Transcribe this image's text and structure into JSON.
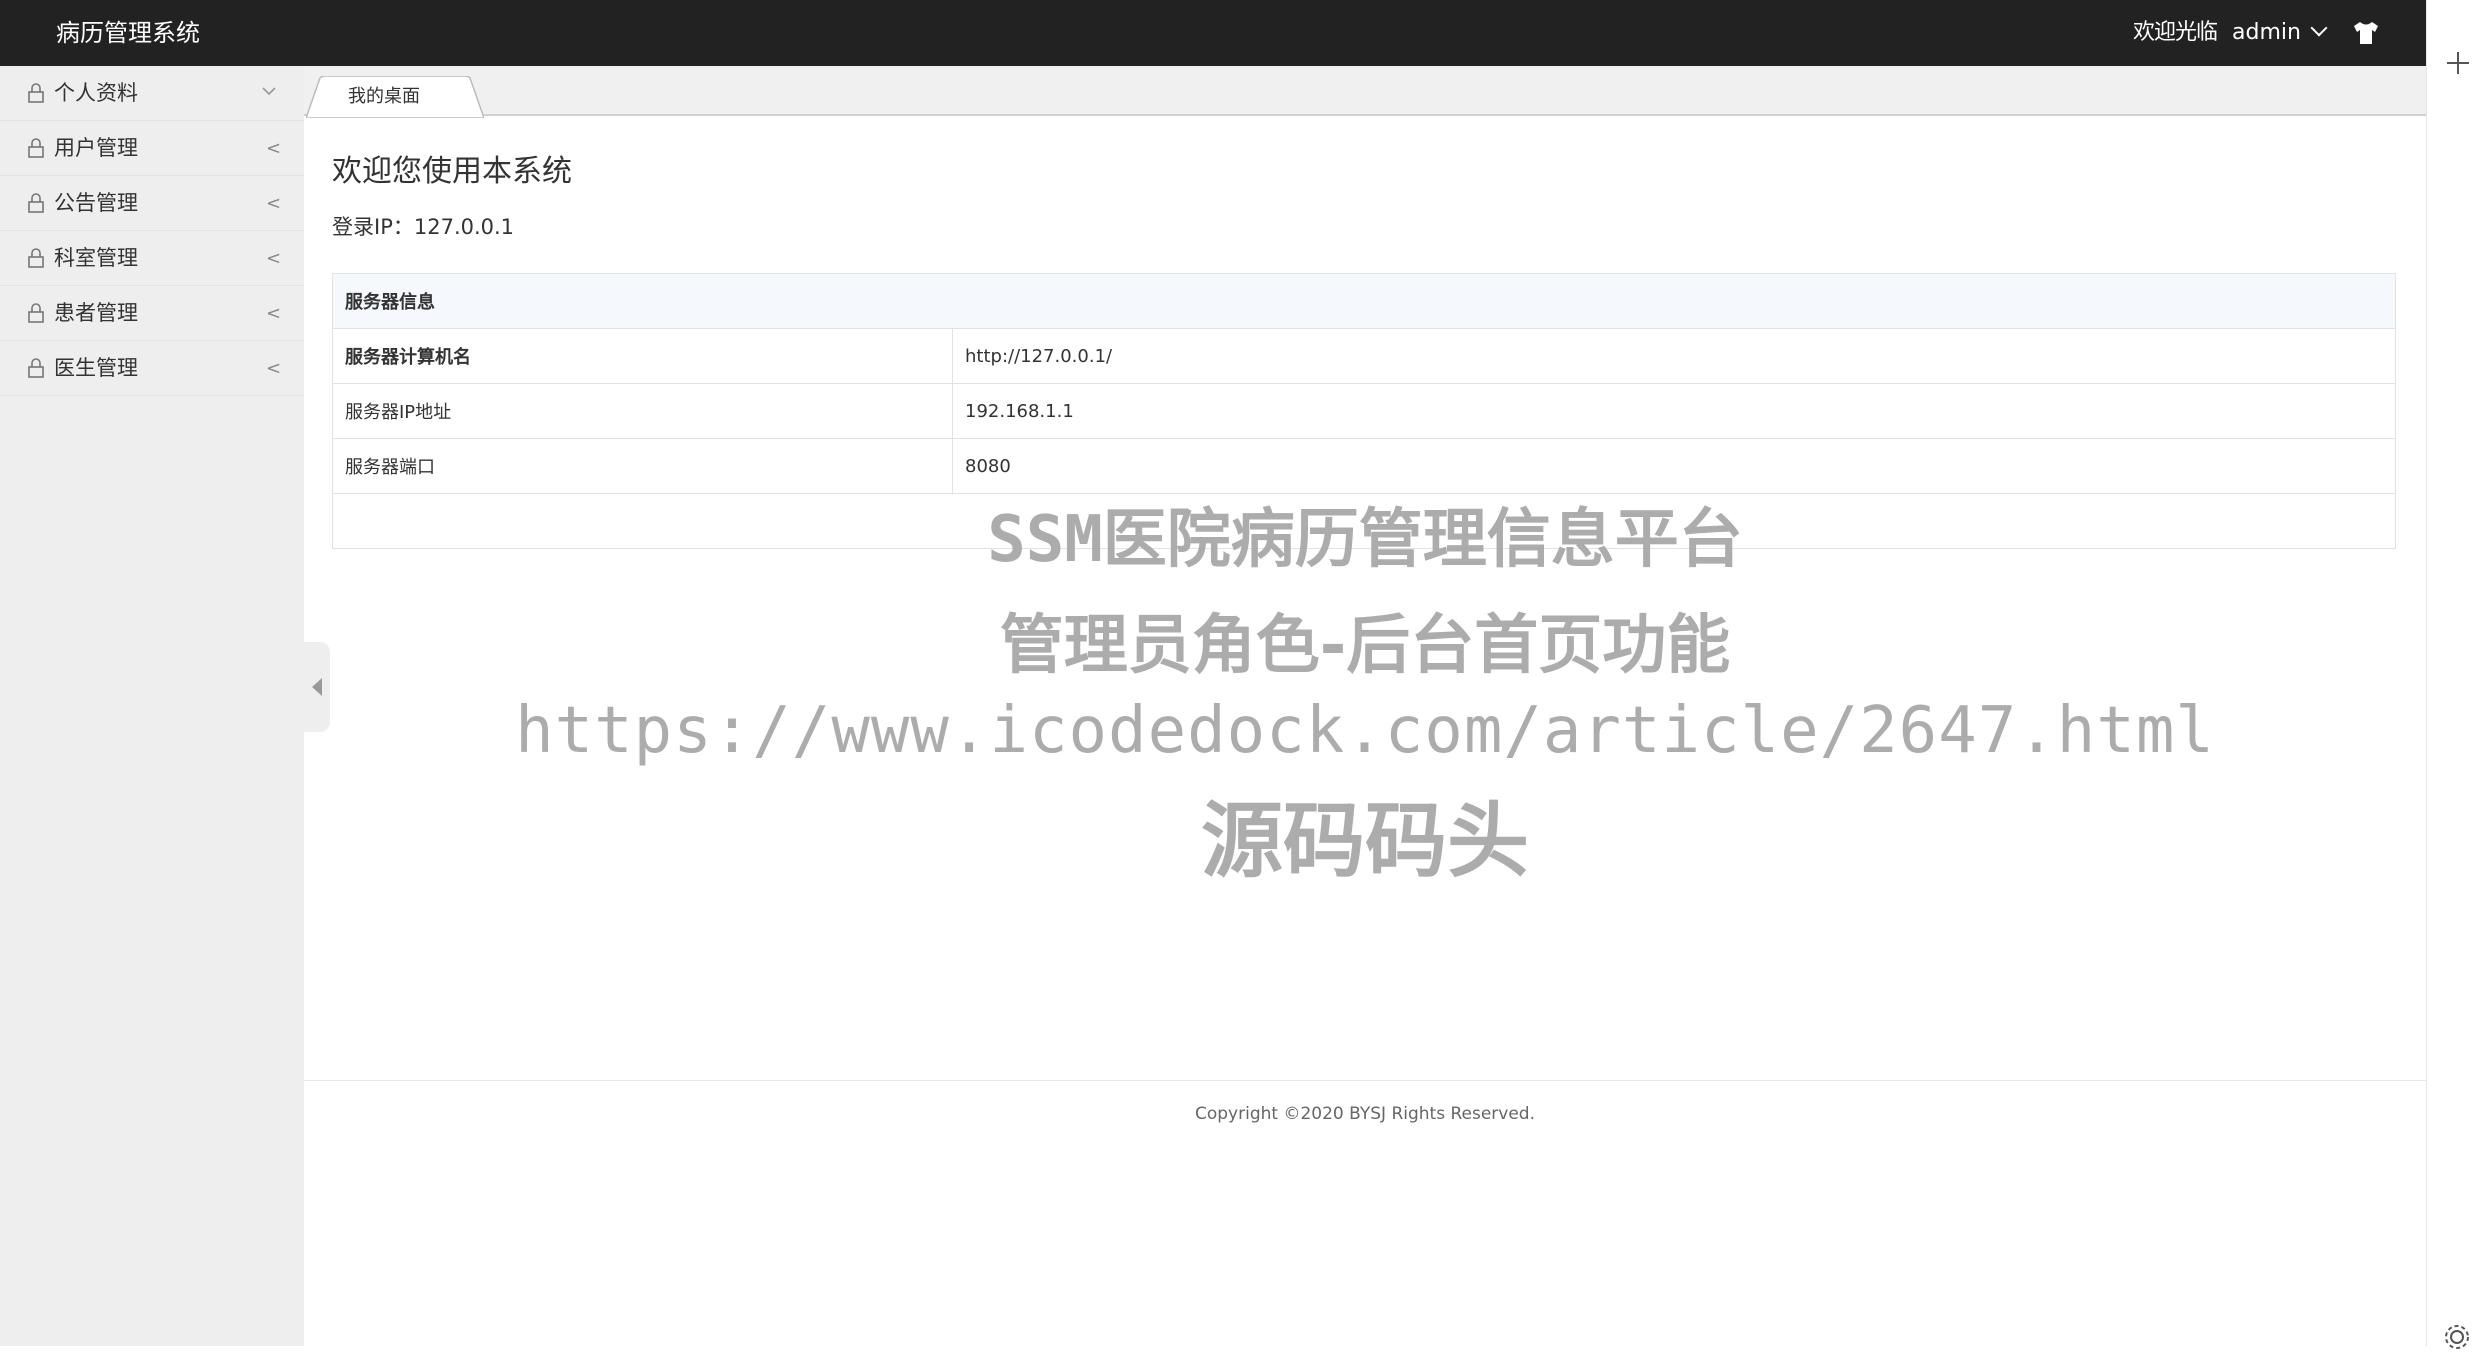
{
  "header": {
    "brand": "病历管理系统",
    "welcome": "欢迎光临",
    "username": "admin"
  },
  "sidebar": {
    "items": [
      {
        "label": "个人资料",
        "icon": "lock-icon",
        "expanded": true
      },
      {
        "label": "用户管理",
        "icon": "lock-icon",
        "arrow": "<"
      },
      {
        "label": "公告管理",
        "icon": "lock-icon",
        "arrow": "<"
      },
      {
        "label": "科室管理",
        "icon": "lock-icon",
        "arrow": "<"
      },
      {
        "label": "患者管理",
        "icon": "lock-icon",
        "arrow": "<"
      },
      {
        "label": "医生管理",
        "icon": "lock-icon",
        "arrow": "<"
      }
    ]
  },
  "tabs": [
    {
      "label": "我的桌面"
    }
  ],
  "main": {
    "title": "欢迎您使用本系统",
    "login_ip": "登录IP：127.0.0.1",
    "server_table": {
      "header": "服务器信息",
      "rows": [
        {
          "key": "服务器计算机名",
          "value": "http://127.0.0.1/"
        },
        {
          "key": "服务器IP地址",
          "value": "192.168.1.1"
        },
        {
          "key": "服务器端口",
          "value": "8080"
        }
      ]
    }
  },
  "footer": {
    "copyright": "Copyright ©2020 BYSJ Rights Reserved."
  },
  "watermark": {
    "line1": "SSM医院病历管理信息平台",
    "line2": "管理员角色-后台首页功能",
    "line3": "https://www.icodedock.com/article/2647.html",
    "line4": "源码码头"
  },
  "colors": {
    "header_bg": "#222222",
    "sidebar_bg": "#eeeeee",
    "table_head_bg": "#f5f9fd",
    "watermark": "#a8a8a8"
  }
}
